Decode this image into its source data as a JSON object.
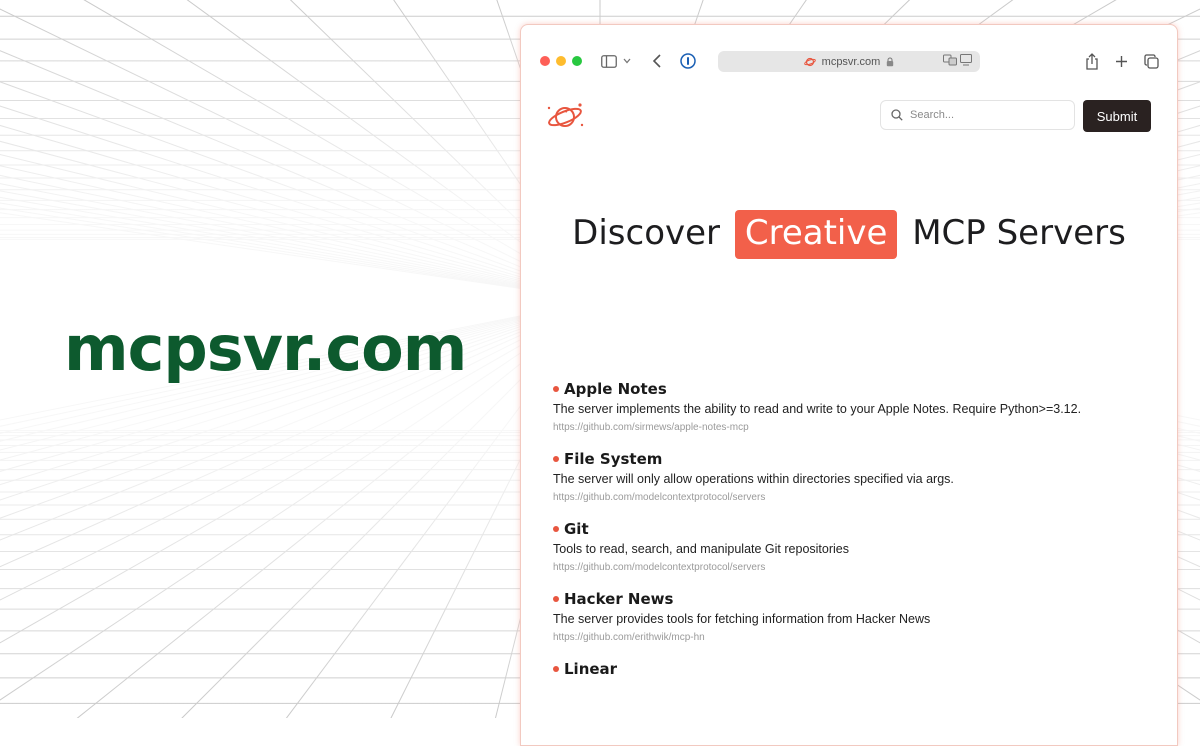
{
  "promo": {
    "brand_text": "mcpsvr.com"
  },
  "browser": {
    "address": "mcpsvr.com"
  },
  "site": {
    "search_placeholder": "Search...",
    "submit_label": "Submit",
    "hero": {
      "before": "Discover",
      "highlight": "Creative",
      "after": "MCP Servers"
    },
    "servers": [
      {
        "name": "Apple Notes",
        "description": "The server implements the ability to read and write to your Apple Notes. Require Python>=3.12.",
        "url": "https://github.com/sirmews/apple-notes-mcp"
      },
      {
        "name": "File System",
        "description": "The server will only allow operations within directories specified via args.",
        "url": "https://github.com/modelcontextprotocol/servers"
      },
      {
        "name": "Git",
        "description": "Tools to read, search, and manipulate Git repositories",
        "url": "https://github.com/modelcontextprotocol/servers"
      },
      {
        "name": "Hacker News",
        "description": "The server provides tools for fetching information from Hacker News",
        "url": "https://github.com/erithwik/mcp-hn"
      },
      {
        "name": "Linear",
        "description": "",
        "url": ""
      }
    ]
  },
  "colors": {
    "brand_green": "#0d5a2e",
    "accent": "#f2604a",
    "submit_bg": "#2a2221",
    "bullet": "#e8563f"
  },
  "icons": [
    "sidebar-icon",
    "chevron-down-icon",
    "back-arrow-icon",
    "password-manager-icon",
    "lock-icon",
    "translate-icon",
    "reader-icon",
    "share-icon",
    "plus-icon",
    "tabs-icon",
    "planet-logo-icon",
    "search-icon"
  ]
}
